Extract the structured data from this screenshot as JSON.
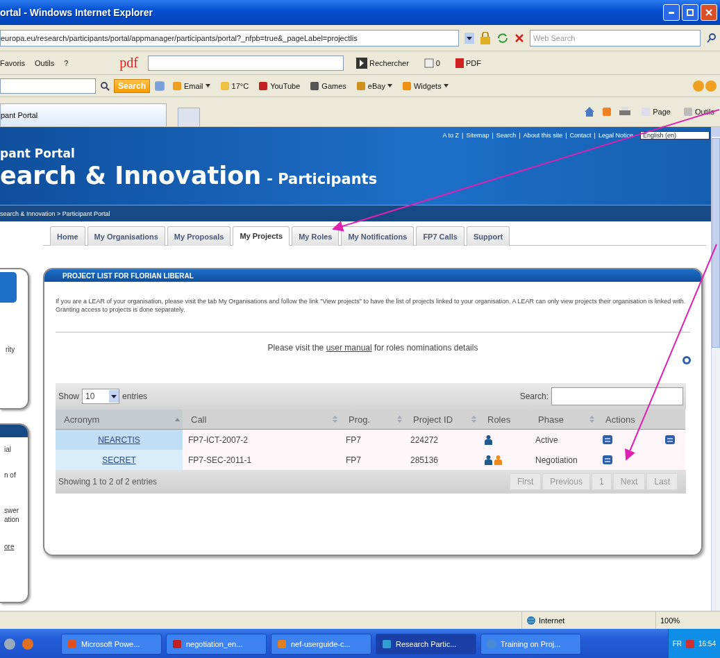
{
  "window": {
    "title": "ortal - Windows Internet Explorer"
  },
  "address_bar": {
    "url": "europa.eu/research/participants/portal/appmanager/participants/portal?_nfpb=true&_pageLabel=projectlis",
    "search_placeholder": "Web Search"
  },
  "menu": [
    "Favoris",
    "Outils",
    "?"
  ],
  "pdf_toolbar": {
    "logo": "pdf",
    "search_button": "Rechercher",
    "count": "0",
    "pdf_button": "PDF"
  },
  "links_toolbar": {
    "search_button": "Search",
    "items": [
      {
        "label": "Email",
        "dropdown": true
      },
      {
        "label": "17°C",
        "dropdown": false
      },
      {
        "label": "YouTube",
        "dropdown": false
      },
      {
        "label": "Games",
        "dropdown": false
      },
      {
        "label": "eBay",
        "dropdown": true
      },
      {
        "label": "Widgets",
        "dropdown": true
      }
    ]
  },
  "browser_tabs": [
    {
      "label": "pant Portal",
      "selected": true
    }
  ],
  "command_bar": [
    "Page",
    "Outils"
  ],
  "site_header": {
    "separator": "|",
    "top_links": [
      "A to Z",
      "Sitemap",
      "Search",
      "About this site",
      "Contact",
      "Legal Notice"
    ],
    "language": "English (en)",
    "subtitle": "pant Portal",
    "title": "earch & Innovation",
    "title_suffix": "- Participants"
  },
  "breadcrumb": {
    "separator": ">",
    "items": [
      "search & Innovation",
      "Participant Portal"
    ]
  },
  "nav_tabs": [
    {
      "label": "Home",
      "selected": false
    },
    {
      "label": "My Organisations",
      "selected": false
    },
    {
      "label": "My Proposals",
      "selected": false
    },
    {
      "label": "My Projects",
      "selected": true
    },
    {
      "label": "My Roles",
      "selected": false
    },
    {
      "label": "My Notifications",
      "selected": false
    },
    {
      "label": "FP7 Calls",
      "selected": false
    },
    {
      "label": "Support",
      "selected": false
    }
  ],
  "sidebar_panels": [
    {
      "texts": [
        "rity"
      ]
    },
    {
      "texts": [
        "ial",
        "n of",
        "swer",
        "ation",
        "ore"
      ]
    }
  ],
  "panel": {
    "title": "PROJECT LIST FOR FLORIAN LIBERAL",
    "intro": "If you are a LEAR of your organisation, please visit the tab My Organisations and follow the link \"View projects\" to have the list of projects linked to your organisation. A LEAR can only view projects their organisation is linked with. Granting access to projects is done separately.",
    "manual_note": {
      "before": "Please visit the",
      "link": "user manual",
      "after": "for roles nominations details"
    }
  },
  "table": {
    "show_label": "Show",
    "page_size": "10",
    "entries_label": "entries",
    "search_label": "Search:",
    "columns": [
      {
        "label": "Acronym",
        "sortable": true,
        "sorted": true
      },
      {
        "label": "Call",
        "sortable": true,
        "sorted": false
      },
      {
        "label": "Prog.",
        "sortable": true,
        "sorted": false
      },
      {
        "label": "Project ID",
        "sortable": true,
        "sorted": false
      },
      {
        "label": "Roles",
        "sortable": false,
        "sorted": false
      },
      {
        "label": "Phase",
        "sortable": true,
        "sorted": false
      },
      {
        "label": "Actions",
        "sortable": false,
        "sorted": false
      }
    ],
    "rows": [
      {
        "acronym": "NEARCTIS",
        "call": "FP7-ICT-2007-2",
        "prog": "FP7",
        "project_id": "224272",
        "roles": [
          {
            "color": "#1f5b8e"
          }
        ],
        "phase": "Active",
        "actions": [
          {
            "kind": "badge"
          }
        ],
        "extra_actions": [
          {
            "kind": "badge"
          }
        ]
      },
      {
        "acronym": "SECRET",
        "call": "FP7-SEC-2011-1",
        "prog": "FP7",
        "project_id": "285136",
        "roles": [
          {
            "color": "#1f5b8e"
          },
          {
            "color": "#f08a1c"
          }
        ],
        "phase": "Negotiation",
        "actions": [
          {
            "kind": "badge"
          }
        ]
      }
    ],
    "info": "Showing 1 to 2 of 2 entries",
    "pagination": [
      "First",
      "Previous",
      "1",
      "Next",
      "Last"
    ]
  },
  "status_bar": {
    "zone": "Internet",
    "zoom": "100%"
  },
  "taskbar": {
    "items": [
      {
        "label": "Microsoft Powe...",
        "selected": false
      },
      {
        "label": "negotiation_en...",
        "selected": false
      },
      {
        "label": "nef-userguide-c...",
        "selected": false
      },
      {
        "label": "Research Partic...",
        "selected": true
      },
      {
        "label": "Training on Proj...",
        "selected": false
      }
    ],
    "language": "FR",
    "clock": "16:54"
  }
}
